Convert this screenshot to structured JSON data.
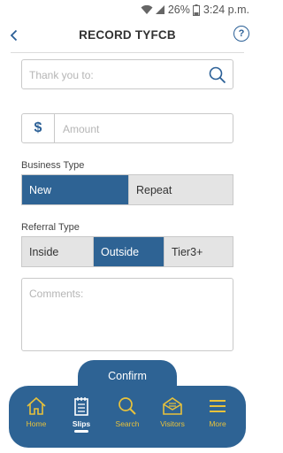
{
  "status_bar": {
    "battery": "26%",
    "time": "3:24 p.m."
  },
  "header": {
    "title": "RECORD TYFCB",
    "help_icon": "?"
  },
  "form": {
    "thank_you_placeholder": "Thank you to:",
    "currency_symbol": "$",
    "amount_placeholder": "Amount",
    "business_type": {
      "label": "Business Type",
      "options": [
        "New",
        "Repeat"
      ],
      "selected": "New"
    },
    "referral_type": {
      "label": "Referral Type",
      "options": [
        "Inside",
        "Outside",
        "Tier3+"
      ],
      "selected": "Outside"
    },
    "comments_placeholder": "Comments:"
  },
  "confirm_label": "Confirm",
  "tabs": [
    {
      "label": "Home",
      "icon": "home-icon"
    },
    {
      "label": "Slips",
      "icon": "slips-icon",
      "active": true
    },
    {
      "label": "Search",
      "icon": "search-icon"
    },
    {
      "label": "Visitors",
      "icon": "visitors-icon"
    },
    {
      "label": "More",
      "icon": "menu-icon"
    }
  ],
  "colors": {
    "primary": "#2e6394",
    "tab_label": "#e8c23b",
    "segment_bg": "#e4e4e4"
  }
}
